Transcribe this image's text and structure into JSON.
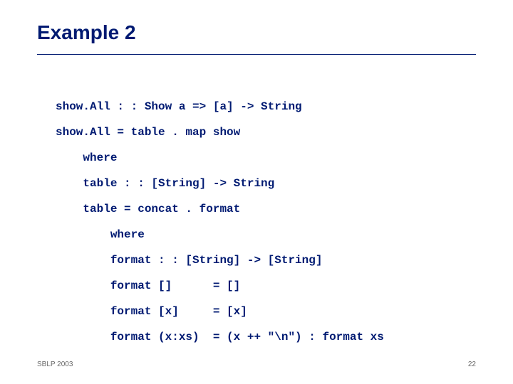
{
  "title": "Example 2",
  "code": {
    "l1": "show.All : : Show a => [a] -> String",
    "l2": "show.All = table . map show",
    "l3": "    where",
    "l4": "    table : : [String] -> String",
    "l5": "    table = concat . format",
    "l6": "        where",
    "l7": "        format : : [String] -> [String]",
    "l8": "        format []      = []",
    "l9": "        format [x]     = [x]",
    "l10": "        format (x:xs)  = (x ++ \"\\n\") : format xs"
  },
  "footer": {
    "left": "SBLP 2003",
    "right": "22"
  }
}
